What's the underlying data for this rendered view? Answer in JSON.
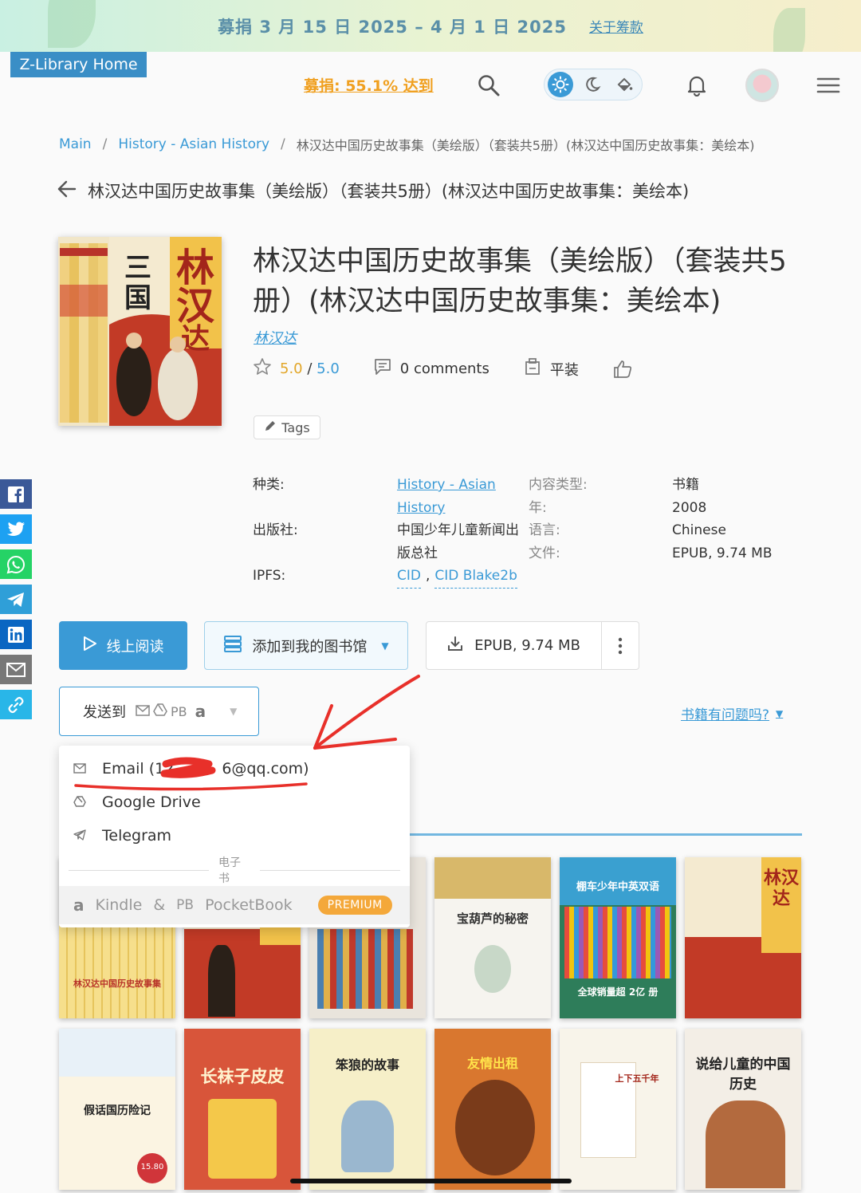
{
  "banner": {
    "text": "募捐 3 月 15 日 2025 – 4 月 1 日 2025",
    "link": "关于筹款"
  },
  "header": {
    "home_label": "Z-Library Home",
    "donate_label": "募捐: 55.1% 达到"
  },
  "breadcrumb": {
    "main": "Main",
    "category": "History - Asian History",
    "current": "林汉达中国历史故事集（美绘版）（套装共5册）(林汉达中国历史故事集：美绘本)"
  },
  "page": {
    "back_title": "林汉达中国历史故事集（美绘版）（套装共5册）(林汉达中国历史故事集：美绘本)"
  },
  "book": {
    "title": "林汉达中国历史故事集（美绘版）（套装共5册）(林汉达中国历史故事集：美绘本)",
    "author": "林汉达",
    "rating": "5.0",
    "rating_sep": " / ",
    "rating_max": "5.0",
    "comments": "0 comments",
    "format_label": "平装",
    "tags_label": "Tags"
  },
  "properties": {
    "category_label": "种类:",
    "category_value": "History - Asian History",
    "publisher_label": "出版社:",
    "publisher_value": "中国少年儿童新闻出版总社",
    "ipfs_label": "IPFS:",
    "ipfs_cid": "CID",
    "ipfs_comma": ",",
    "ipfs_blake": "CID Blake2b",
    "content_type_label": "内容类型:",
    "content_type_value": "书籍",
    "year_label": "年:",
    "year_value": "2008",
    "language_label": "语言:",
    "language_value": "Chinese",
    "file_label": "文件:",
    "file_value": "EPUB, 9.74 MB"
  },
  "actions": {
    "read_online": "线上阅读",
    "add_to_library": "添加到我的图书馆",
    "download": "EPUB, 9.74 MB",
    "send_to": "发送到",
    "send_pb": "PB",
    "problem_link": "书籍有问题吗?"
  },
  "dropdown": {
    "email": "Email (12",
    "email_end": "6@qq.com)",
    "google_drive": "Google Drive",
    "telegram": "Telegram",
    "section": "电子书",
    "kindle": "Kindle",
    "amp": "&",
    "pb": "PB",
    "pocketbook": "PocketBook",
    "premium": "PREMIUM"
  },
  "related": {
    "b1_caption": "林汉达中国历史故事集",
    "b4_caption": "宝葫芦的秘密",
    "b5_caption": "棚车少年中英双语",
    "b5_sub": "全球销量超 2亿 册",
    "b6_caption": "林汉达",
    "b7_caption": "假话国历险记",
    "b7_price": "15.80",
    "b8_caption": "长袜子皮皮",
    "b9_caption": "笨狼的故事",
    "b10_caption": "友情出租",
    "b11_caption": "上下五千年",
    "b12_caption": "说给儿童的中国历史"
  },
  "colors": {
    "accent": "#3a9ad6",
    "donate": "#f0a020",
    "premium": "#f4a83a",
    "annotation_red": "#e8302a"
  },
  "icons": [
    "search-icon",
    "sun-icon",
    "moon-icon",
    "paint-bucket-icon",
    "bell-icon",
    "hamburger-menu-icon",
    "back-arrow-icon",
    "star-icon",
    "comment-icon",
    "binding-icon",
    "thumbs-up-icon",
    "pencil-icon",
    "facebook-icon",
    "twitter-icon",
    "whatsapp-icon",
    "telegram-icon",
    "linkedin-icon",
    "email-icon",
    "link-icon",
    "play-icon",
    "library-icon",
    "download-icon",
    "kebab-icon"
  ]
}
